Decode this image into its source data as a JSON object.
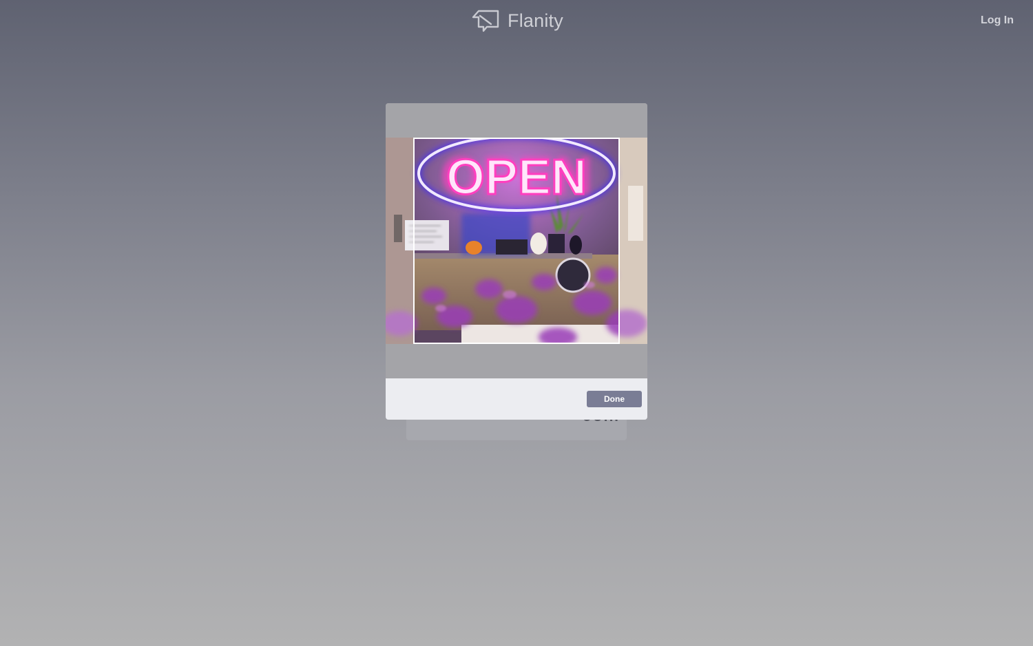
{
  "header": {
    "brand": "Flanity",
    "logo_icon": "flanity-logo-icon",
    "login_label": "Log In"
  },
  "background_card": {
    "partial_text": "Join"
  },
  "crop_dialog": {
    "photo_description_icon": "open-neon-sign-photo",
    "sign_text": "OPEN",
    "done_label": "Done"
  },
  "colors": {
    "accent_button": "#7a7d95",
    "neon_pink": "#ff2fb4",
    "neon_blue": "#4a3cff"
  }
}
